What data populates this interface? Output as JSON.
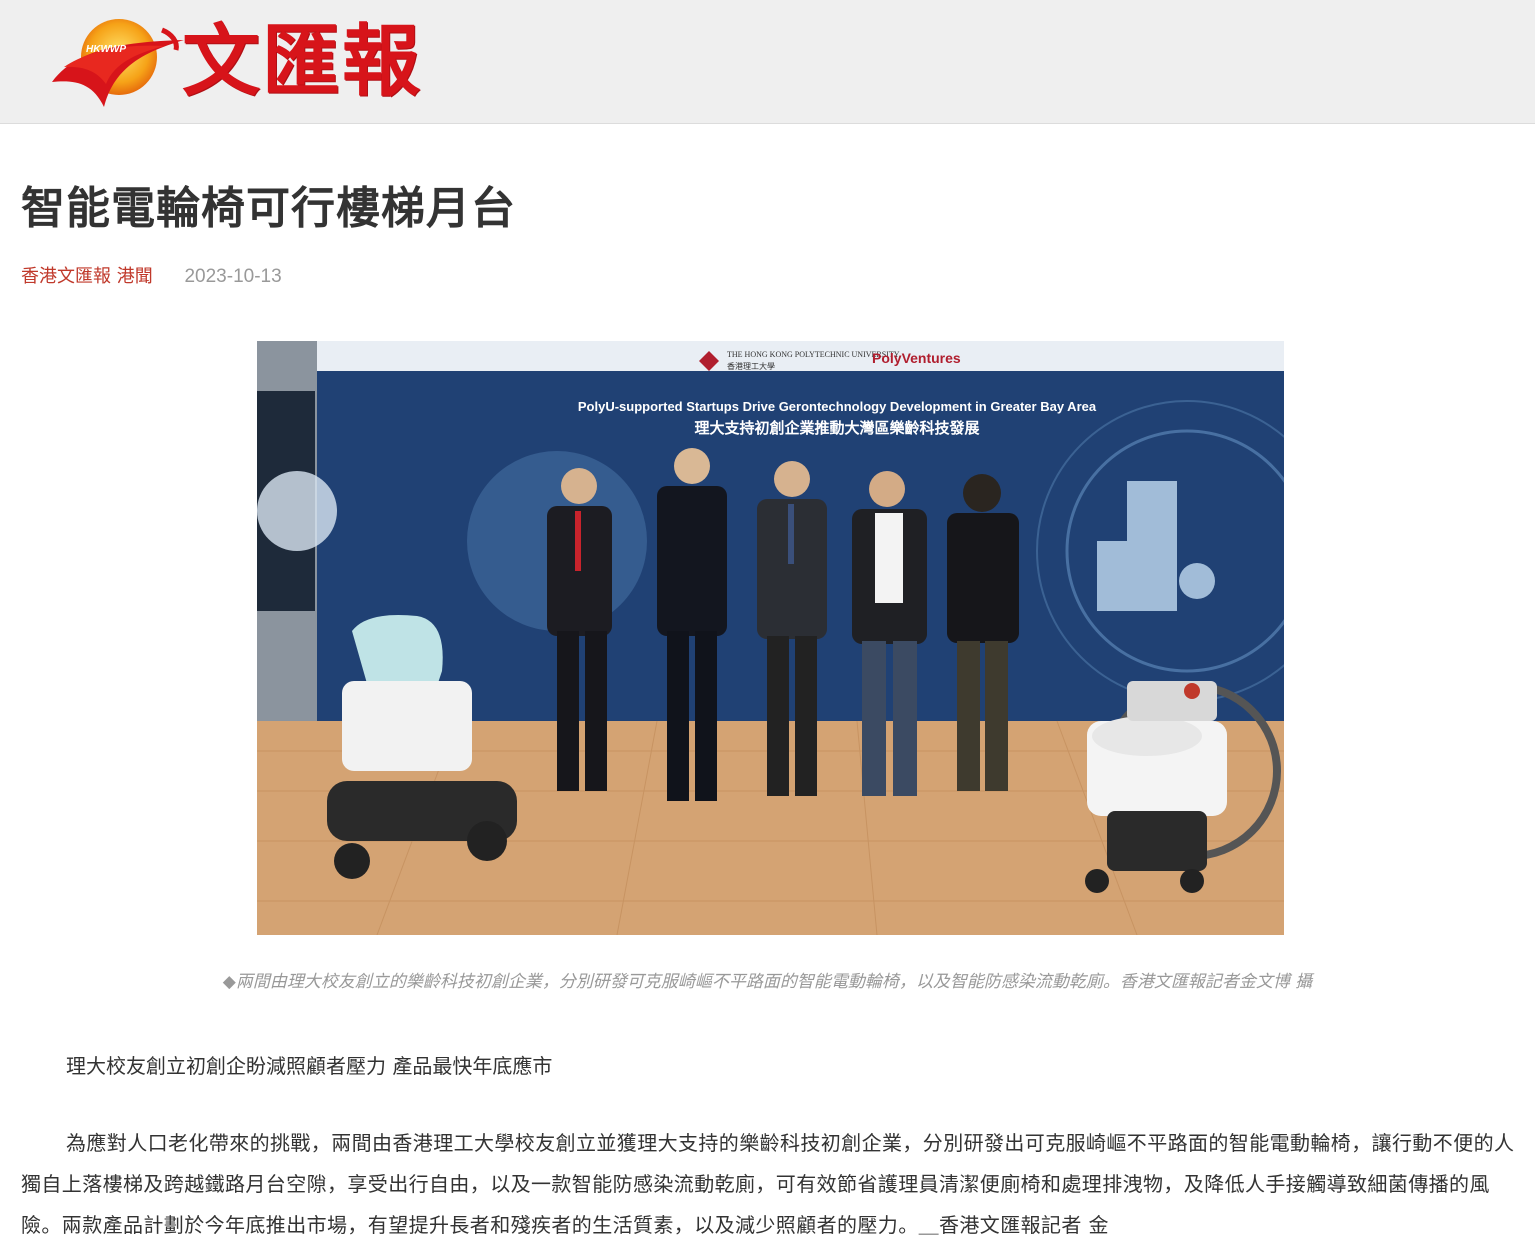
{
  "header": {
    "logo_badge": "HKWWP",
    "logo_text": "文匯報"
  },
  "article": {
    "title": "智能電輪椅可行樓梯月台",
    "source": "香港文匯報 港聞",
    "date": "2023-10-13",
    "photo": {
      "backdrop_logo_university_en": "THE HONG KONG POLYTECHNIC UNIVERSITY",
      "backdrop_logo_university_zh": "香港理工大學",
      "backdrop_logo_ventures": "PolyVentures",
      "backdrop_title_en": "PolyU-supported Startups Drive Gerontechnology Development in Greater Bay Area",
      "backdrop_title_zh": "理大支持初創企業推動大灣區樂齡科技發展"
    },
    "caption": "◆兩間由理大校友創立的樂齡科技初創企業，分別研發可克服崎嶇不平路面的智能電動輪椅，以及智能防感染流動乾廁。香港文匯報記者金文博 攝",
    "subheading": "理大校友創立初創企盼減照顧者壓力 產品最快年底應市",
    "paragraph": "為應對人口老化帶來的挑戰，兩間由香港理工大學校友創立並獲理大支持的樂齡科技初創企業，分別研發出可克服崎嶇不平路面的智能電動輪椅，讓行動不便的人獨自上落樓梯及跨越鐵路月台空隙，享受出行自由，以及一款智能防感染流動乾廁，可有效節省護理員清潔便廁椅和處理排洩物，及降低人手接觸導致細菌傳播的風險。兩款產品計劃於今年底推出市場，有望提升長者和殘疾者的生活質素，以及減少照顧者的壓力。＿香港文匯報記者 金"
  },
  "colors": {
    "brand_red": "#d7141a",
    "source_red": "#c0392b",
    "header_bg": "#efefef",
    "backdrop_navy": "#1f3c6e",
    "floor_wood": "#d4a373"
  },
  "icons": [
    "logo-flame-icon"
  ]
}
